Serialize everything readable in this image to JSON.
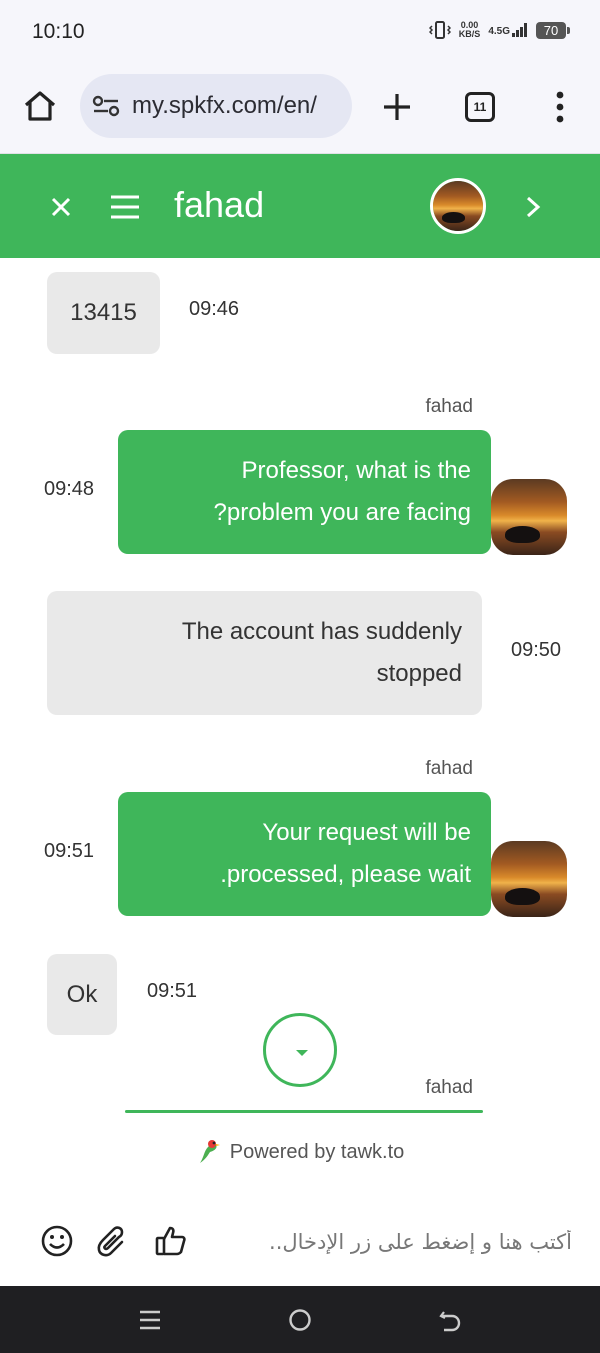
{
  "status_bar": {
    "time": "10:10",
    "net_speed_value": "0.00",
    "net_speed_unit": "KB/S",
    "network": "4.5G",
    "battery": "70"
  },
  "browser": {
    "url": "my.spkfx.com/en/",
    "tab_count": "11",
    "icons": [
      "home-icon",
      "site-settings-icon",
      "plus-icon",
      "more-vertical-icon"
    ]
  },
  "chat_header": {
    "agent_name": "fahad",
    "color": "#3fb65a"
  },
  "messages": [
    {
      "direction": "incoming",
      "text": "13415",
      "time": "09:46"
    },
    {
      "direction": "outgoing",
      "sender": "fahad",
      "line1": "Professor, what is the",
      "line2": "?problem you are facing",
      "time": "09:48"
    },
    {
      "direction": "incoming",
      "line1": "The account has suddenly",
      "line2": "stopped",
      "time": "09:50"
    },
    {
      "direction": "outgoing",
      "sender": "fahad",
      "line1": "Your request will be",
      "line2": ".processed, please wait",
      "time": "09:51"
    },
    {
      "direction": "incoming",
      "text": "Ok",
      "time": "09:51"
    },
    {
      "direction": "outgoing",
      "sender": "fahad"
    }
  ],
  "footer": {
    "powered_by": "Powered by tawk.to"
  },
  "composer": {
    "placeholder": "أكتب هنا و إضغط على زر الإدخال.."
  }
}
